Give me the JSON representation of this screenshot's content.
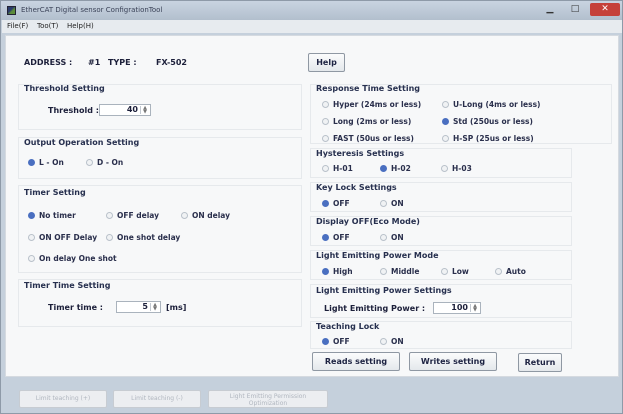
{
  "window": {
    "title": "EtherCAT Digital sensor ConfigrationTool",
    "min": "▁",
    "max": "□",
    "close": "✕"
  },
  "menu": {
    "file": "File(F)",
    "tool": "Too(T)",
    "help": "Help(H)"
  },
  "header": {
    "address_label": "ADDRESS :",
    "address_value": "#1",
    "type_label": "TYPE :",
    "type_value": "FX-502",
    "help_button": "Help"
  },
  "threshold": {
    "title": "Threshold Setting",
    "label": "Threshold :",
    "value": "40"
  },
  "output_operation": {
    "title": "Output Operation Setting",
    "opt1": "L - On",
    "opt2": "D - On"
  },
  "timer_setting": {
    "title": "Timer Setting",
    "no_timer": "No timer",
    "off_delay": "OFF delay",
    "on_delay": "ON delay",
    "on_off_delay": "ON OFF Delay",
    "one_shot_delay": "One shot delay",
    "on_delay_one_shot": "On delay One shot"
  },
  "timer_time": {
    "title": "Timer Time Setting",
    "label": "Timer time :",
    "value": "5",
    "unit": "[ms]"
  },
  "response_time": {
    "title": "Response Time Setting",
    "hyper": "Hyper (24ms or less)",
    "u_long": "U-Long (4ms or less)",
    "long": "Long (2ms or less)",
    "std": "Std (250us or less)",
    "fast": "FAST (50us or less)",
    "h_sp": "H-SP (25us or less)"
  },
  "hysteresis": {
    "title": "Hysteresis Settings",
    "h01": "H-01",
    "h02": "H-02",
    "h03": "H-03"
  },
  "key_lock": {
    "title": "Key Lock Settings",
    "off": "OFF",
    "on": "ON"
  },
  "display_off": {
    "title": "Display OFF(Eco Mode)",
    "off": "OFF",
    "on": "ON"
  },
  "light_mode": {
    "title": "Light Emitting Power Mode",
    "high": "High",
    "middle": "Middle",
    "low": "Low",
    "auto": "Auto"
  },
  "light_power": {
    "title": "Light Emitting Power Settings",
    "label": "Light Emitting Power :",
    "value": "100"
  },
  "teaching_lock": {
    "title": "Teaching Lock",
    "off": "OFF",
    "on": "ON"
  },
  "actions": {
    "reads": "Reads setting",
    "writes": "Writes setting",
    "return": "Return"
  },
  "bottom": {
    "limit_plus": "Limit teaching (+)",
    "limit_minus": "Limit teaching (-)",
    "light_opt_1": "Light Emitting Permission",
    "light_opt_2": "Optimization"
  }
}
